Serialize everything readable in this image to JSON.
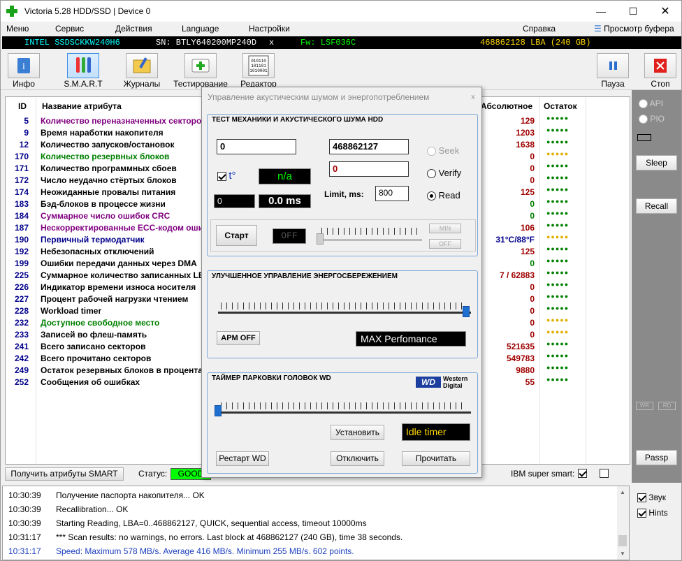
{
  "title": "Victoria 5.28 HDD/SSD | Device 0",
  "colors": {
    "accent": "#0078d7",
    "good": "#00ff00",
    "red_value": "#a00000",
    "dark_blue_id": "#00008b"
  },
  "menu": {
    "m1": "Меню",
    "m2": "Сервис",
    "m3": "Действия",
    "m4": "Language",
    "m5": "Настройки",
    "help": "Справка",
    "viewbuf": "Просмотр буфера"
  },
  "info": {
    "model": "INTEL SSDSCKKW240H6",
    "serial": "SN: BTLY640200MP240D",
    "x": "x",
    "fw": "Fw: LSF036C",
    "lba": "468862128 LBA (240 GB)"
  },
  "toolbar": {
    "info": "Инфо",
    "smart": "S.M.A.R.T",
    "logs": "Журналы",
    "test": "Тестирование",
    "editor": "Редактор",
    "pause": "Пауза",
    "stop": "Стоп"
  },
  "table": {
    "h_id": "ID",
    "h_name": "Название атрибута",
    "h_abs": "Абсолютное",
    "h_rest": "Остаток",
    "rows": [
      {
        "id": "5",
        "name": "Количество переназначенных секторов",
        "val": "129",
        "color": "#800080",
        "dot": "#008000"
      },
      {
        "id": "9",
        "name": "Время наработки накопителя",
        "val": "1203",
        "color": "#000000",
        "dot": "#008000"
      },
      {
        "id": "12",
        "name": "Количество запусков/остановок",
        "val": "1638",
        "color": "#000000",
        "dot": "#008000"
      },
      {
        "id": "170",
        "name": "Количество резервных блоков",
        "val": "0",
        "color": "#008000",
        "dot": "#e0b000"
      },
      {
        "id": "171",
        "name": "Количество программных сбоев",
        "val": "0",
        "color": "#000000",
        "dot": "#008000"
      },
      {
        "id": "172",
        "name": "Число неудачно стёртых блоков",
        "val": "0",
        "color": "#000000",
        "dot": "#008000"
      },
      {
        "id": "174",
        "name": "Неожиданные провалы питания",
        "val": "125",
        "color": "#000000",
        "dot": "#008000"
      },
      {
        "id": "183",
        "name": "Бэд-блоков в процессе жизни",
        "val": "0",
        "color": "#000000",
        "dot": "#008000"
      },
      {
        "id": "184",
        "name": "Суммарное число ошибок CRC",
        "val": "0",
        "color": "#800080",
        "dot": "#008000"
      },
      {
        "id": "187",
        "name": "Нескорректированные ECC-кодом ошибки",
        "val": "106",
        "color": "#800080",
        "dot": "#008000"
      },
      {
        "id": "190",
        "name": "Первичный термодатчик",
        "val": "31°C/88°F",
        "color": "#00008b",
        "dot": "#e0b000"
      },
      {
        "id": "192",
        "name": "Небезопасных отключений",
        "val": "125",
        "color": "#000000",
        "dot": "#008000"
      },
      {
        "id": "199",
        "name": "Ошибки передачи данных через DMA",
        "val": "0",
        "color": "#000000",
        "dot": "#008000"
      },
      {
        "id": "225",
        "name": "Суммарное количество записанных LBA",
        "val": "7 / 62883",
        "color": "#000000",
        "dot": "#008000"
      },
      {
        "id": "226",
        "name": "Индикатор времени износа носителя",
        "val": "0",
        "color": "#000000",
        "dot": "#008000"
      },
      {
        "id": "227",
        "name": "Процент рабочей нагрузки чтением",
        "val": "0",
        "color": "#000000",
        "dot": "#008000"
      },
      {
        "id": "228",
        "name": "Workload timer",
        "val": "0",
        "color": "#000000",
        "dot": "#008000"
      },
      {
        "id": "232",
        "name": "Доступное свободное место",
        "val": "0",
        "color": "#008000",
        "dot": "#e0b000"
      },
      {
        "id": "233",
        "name": "Записей во флеш-память",
        "val": "0",
        "color": "#000000",
        "dot": "#e0b000"
      },
      {
        "id": "241",
        "name": "Всего записано секторов",
        "val": "521635",
        "color": "#000000",
        "dot": "#008000"
      },
      {
        "id": "242",
        "name": "Всего прочитано секторов",
        "val": "549783",
        "color": "#000000",
        "dot": "#008000"
      },
      {
        "id": "249",
        "name": "Остаток резервных блоков в процентах",
        "val": "9880",
        "color": "#000000",
        "dot": "#008000"
      },
      {
        "id": "252",
        "name": "Сообщения об ошибках",
        "val": "55",
        "color": "#000000",
        "dot": "#008000"
      }
    ]
  },
  "right": {
    "api": "API",
    "pio": "PIO",
    "sleep": "Sleep",
    "recall": "Recall",
    "wr": "WR",
    "rd": "RD",
    "passp": "Passp",
    "sound": "Звук",
    "hints": "Hints"
  },
  "status": {
    "get_smart": "Получить атрибуты SMART",
    "status_lbl": "Статус:",
    "status_val": "GOOD",
    "ibm": "IBM super smart:"
  },
  "log": [
    {
      "t": "10:30:39",
      "m": "Получение паспорта накопителя... OK",
      "c": "#000000"
    },
    {
      "t": "10:30:39",
      "m": "Recallibration... OK",
      "c": "#000000"
    },
    {
      "t": "10:30:39",
      "m": "Starting Reading, LBA=0..468862127, QUICK, sequential access, timeout 10000ms",
      "c": "#000000"
    },
    {
      "t": "10:31:17",
      "m": "*** Scan results: no warnings, no errors. Last block at 468862127 (240 GB), time 38 seconds.",
      "c": "#000000"
    },
    {
      "t": "10:31:17",
      "m": "Speed: Maximum 578 MB/s. Average 416 MB/s. Minimum 255 MB/s. 602 points.",
      "c": "#1c3fbf"
    }
  ],
  "dialog": {
    "title": "Управление акустическим шумом и энергопотреблением",
    "close": "x",
    "g1": "ТЕСТ МЕХАНИКИ И АКУСТИЧЕСКОГО ШУМА HDD",
    "f_start": "0",
    "f_end": "468862127",
    "f_err": "0",
    "temp_lbl": "t°",
    "temp_val": "n/a",
    "f_small": "0",
    "ms": "0.0 ms",
    "limit_lbl": "Limit, ms:",
    "limit": "800",
    "seek": "Seek",
    "verify": "Verify",
    "read": "Read",
    "start": "Старт",
    "off_led": "OFF",
    "min": "MIN",
    "off": "OFF",
    "g2": "УЛУЧШЕННОЕ УПРАВЛЕНИЕ ЭНЕРГОСБЕРЕЖЕНИЕМ",
    "apm": "APM OFF",
    "maxperf": "MAX Perfomance",
    "g3": "ТАЙМЕР ПАРКОВКИ ГОЛОВОК WD",
    "wd_logo": "WD",
    "wd_text1": "Western",
    "wd_text2": "Digital",
    "set": "Установить",
    "idle": "Idle timer",
    "restart": "Рестарт WD",
    "disable": "Отключить",
    "read_btn": "Прочитать"
  }
}
